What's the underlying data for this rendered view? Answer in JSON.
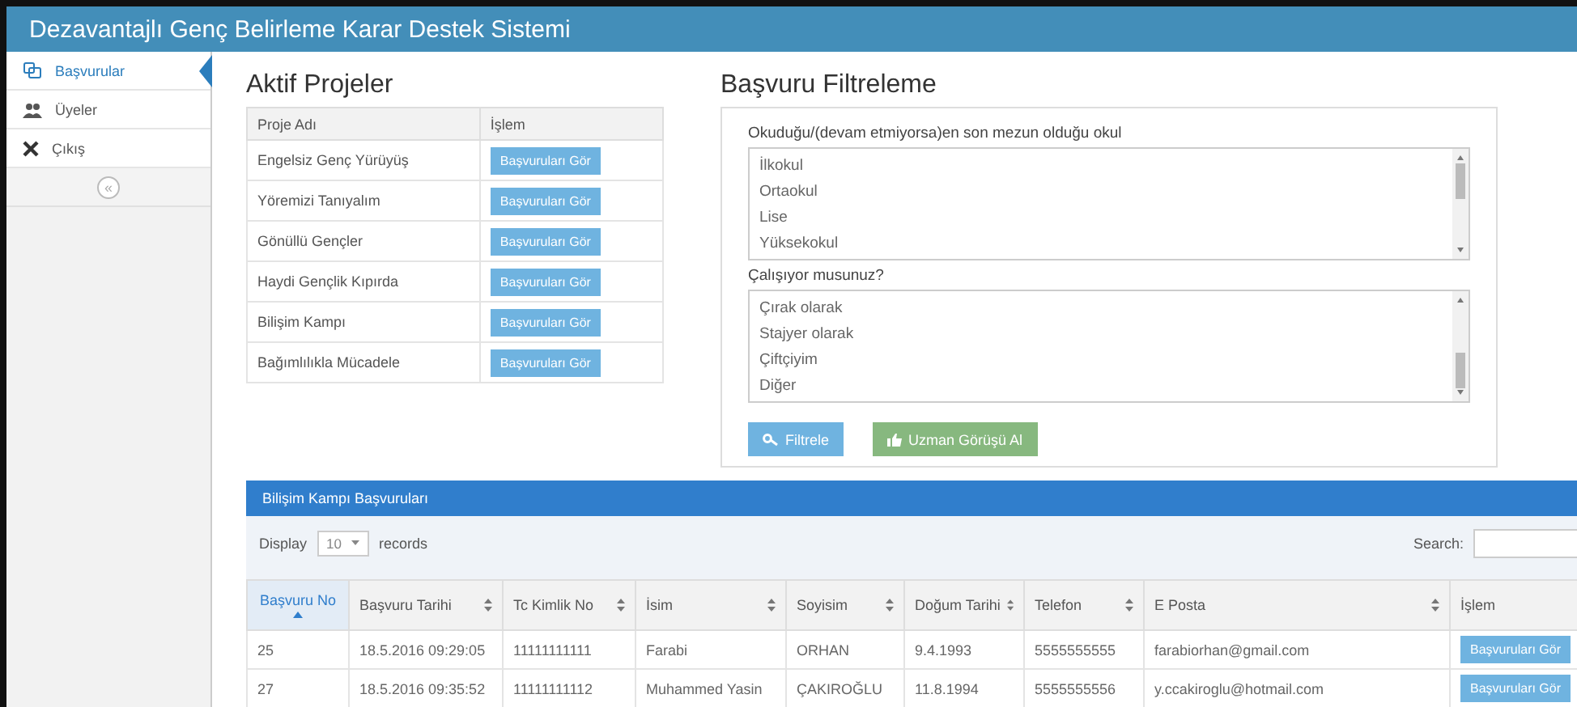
{
  "window": {
    "title": "Dezavantajlı Genç Belirleme Karar Destek Sistemi"
  },
  "sidebar": {
    "items": [
      {
        "label": "Başvurular",
        "kind": "apps",
        "selected": true
      },
      {
        "label": "Üyeler",
        "kind": "users",
        "selected": false
      },
      {
        "label": "Çıkış",
        "kind": "exit",
        "selected": false
      }
    ],
    "collapse": "«"
  },
  "projects": {
    "title": "Aktif Projeler",
    "columns": [
      "Proje Adı",
      "İşlem"
    ],
    "rows": [
      {
        "name": "Engelsiz Genç Yürüyüş",
        "action": "Başvuruları Gör"
      },
      {
        "name": "Yöremizi Tanıyalım",
        "action": "Başvuruları Gör"
      },
      {
        "name": "Gönüllü Gençler",
        "action": "Başvuruları Gör"
      },
      {
        "name": "Haydi Gençlik Kıpırda",
        "action": "Başvuruları Gör"
      },
      {
        "name": "Bilişim Kampı",
        "action": "Başvuruları Gör"
      },
      {
        "name": "Bağımlılıkla Mücadele",
        "action": "Başvuruları Gör"
      }
    ]
  },
  "filter": {
    "title": "Başvuru Filtreleme",
    "groups": [
      {
        "label": "Okuduğu/(devam etmiyorsa)en son mezun olduğu okul",
        "options": [
          "İlkokul",
          "Ortaokul",
          "Lise",
          "Yüksekokul"
        ]
      },
      {
        "label": "Çalışıyor musunuz?",
        "options": [
          "Çırak olarak",
          "Stajyer olarak",
          "Çiftçiyim",
          "Diğer"
        ]
      }
    ],
    "buttons": [
      {
        "label": "Filtrele",
        "kind": "primary"
      },
      {
        "label": "Uzman Görüşü Al",
        "kind": "success"
      }
    ]
  },
  "applications": {
    "title": "Bilişim Kampı Başvuruları",
    "length": {
      "prefix": "Display",
      "value": "10",
      "suffix": "records"
    },
    "search": {
      "label": "Search:"
    },
    "columns": [
      {
        "label": "Başvuru No",
        "sorted": true
      },
      {
        "label": "Başvuru Tarihi",
        "sorted": false
      },
      {
        "label": "Tc Kimlik No",
        "sorted": false
      },
      {
        "label": "İsim",
        "sorted": false
      },
      {
        "label": "Soyisim",
        "sorted": false
      },
      {
        "label": "Doğum Tarihi",
        "sorted": false
      },
      {
        "label": "Telefon",
        "sorted": false
      },
      {
        "label": "E Posta",
        "sorted": false
      },
      {
        "label": "İşlem",
        "sorted": false
      }
    ],
    "rows": [
      {
        "cells": [
          "25",
          "18.5.2016 09:29:05",
          "11111111111",
          "Farabi",
          "ORHAN",
          "9.4.1993",
          "5555555555",
          "farabiorhan@gmail.com"
        ],
        "action": "Başvuruları Gör"
      },
      {
        "cells": [
          "27",
          "18.5.2016 09:35:52",
          "11111111112",
          "Muhammed Yasin",
          "ÇAKIROĞLU",
          "11.8.1994",
          "5555555556",
          "y.ccakiroglu@hotmail.com"
        ],
        "action": "Başvuruları Gör"
      }
    ]
  }
}
